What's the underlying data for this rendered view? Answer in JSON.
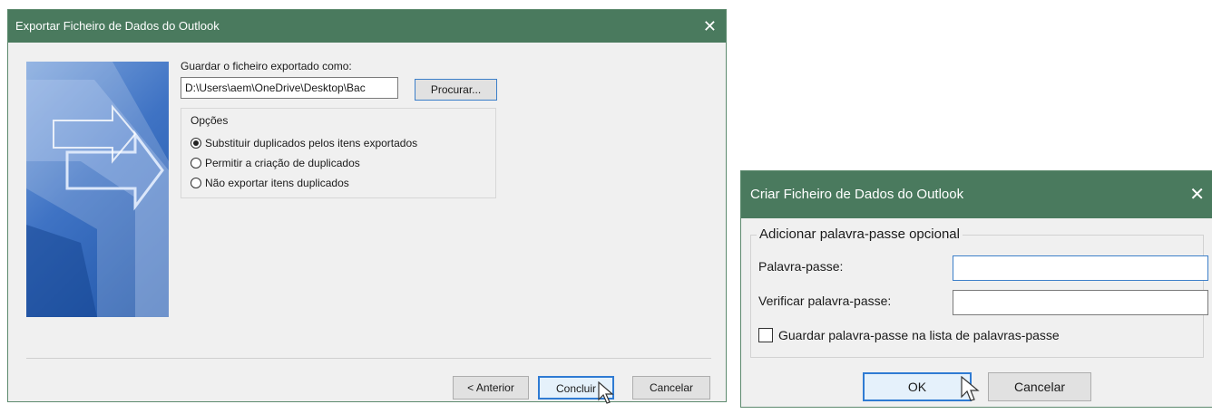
{
  "export_dialog": {
    "title": "Exportar Ficheiro de Dados do Outlook",
    "close_glyph": "✕",
    "save_as_label": "Guardar o ficheiro exportado como:",
    "path_value": "D:\\Users\\aem\\OneDrive\\Desktop\\Bac",
    "browse_label": "Procurar...",
    "options_title": "Opções",
    "options": [
      {
        "label": "Substituir duplicados pelos itens exportados",
        "selected": true
      },
      {
        "label": "Permitir a criação de duplicados",
        "selected": false
      },
      {
        "label": "Não exportar itens duplicados",
        "selected": false
      }
    ],
    "back_label": "< Anterior",
    "finish_label": "Concluir",
    "cancel_label": "Cancelar"
  },
  "create_dialog": {
    "title": "Criar Ficheiro de Dados do Outlook",
    "close_glyph": "✕",
    "group_title": "Adicionar palavra-passe opcional",
    "password_label": "Palavra-passe:",
    "password_value": "",
    "verify_label": "Verificar palavra-passe:",
    "verify_value": "",
    "save_checkbox_label": "Guardar palavra-passe na lista de palavras-passe",
    "save_checkbox_checked": false,
    "ok_label": "OK",
    "cancel_label": "Cancelar"
  },
  "icons": [
    "close-icon",
    "wizard-art-icon",
    "radio-icon",
    "checkbox-icon",
    "mouse-pointer-icon"
  ],
  "colors": {
    "titlebar": "#4a7a5e",
    "dialog_bg": "#f0f0f0",
    "focus_border": "#2f7bd3",
    "art_blue": "#1f55a8"
  }
}
